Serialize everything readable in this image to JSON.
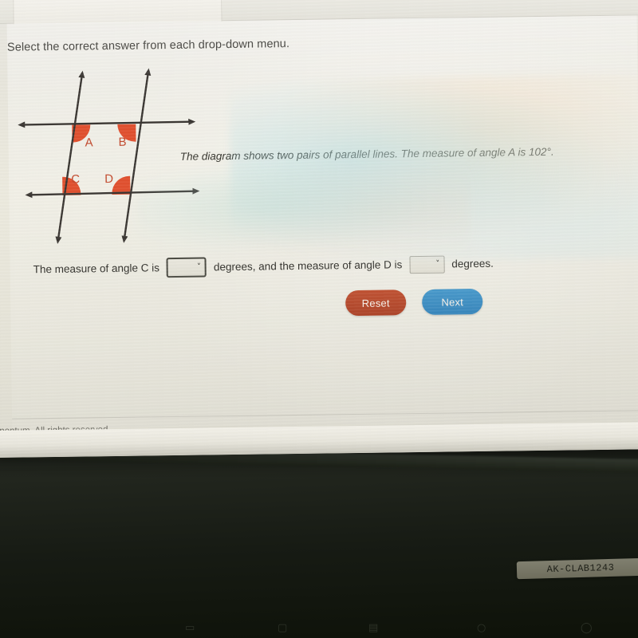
{
  "photo": {
    "device_sticker": "AK-CLAB1243",
    "keyboard_glyphs": [
      "▭",
      "▢",
      "▤",
      "○",
      "◯"
    ]
  },
  "browser": {
    "tab_label": ""
  },
  "page": {
    "instruction": "Select the correct answer from each drop-down menu.",
    "problem_statement": "The diagram shows two pairs of parallel lines. The measure of angle A is 102°.",
    "answer_sentence": {
      "part1": "The measure of angle C is",
      "part2": "degrees, and the measure of angle D is",
      "part3": "degrees."
    },
    "dropdowns": [
      {
        "name": "angle-c-dropdown",
        "value": "",
        "caret": "˅",
        "state": "focused"
      },
      {
        "name": "angle-d-dropdown",
        "value": "",
        "caret": "˅",
        "state": "normal"
      }
    ],
    "buttons": {
      "reset_label": "Reset",
      "next_label": "Next"
    },
    "footer": "nentum. All rights reserved."
  },
  "diagram": {
    "type": "geometry-parallel-lines",
    "angle_labels": [
      "A",
      "B",
      "C",
      "D"
    ],
    "given_angle": "102°",
    "colors": {
      "line": "#3a3632",
      "arc_fill": "#e0502f",
      "label": "#c24a2e"
    },
    "lines": [
      {
        "name": "top-horizontal-line",
        "orientation": "horizontal",
        "arrows": "both"
      },
      {
        "name": "bottom-horizontal-line",
        "orientation": "horizontal",
        "arrows": "both"
      },
      {
        "name": "left-transversal-line",
        "orientation": "slanted",
        "arrows": "both"
      },
      {
        "name": "right-transversal-line",
        "orientation": "slanted",
        "arrows": "both"
      }
    ]
  },
  "colors": {
    "reset_button": "#b54a2e",
    "next_button": "#3d8fc4",
    "screen_bg": "#e6e4db",
    "text": "#34332e"
  }
}
